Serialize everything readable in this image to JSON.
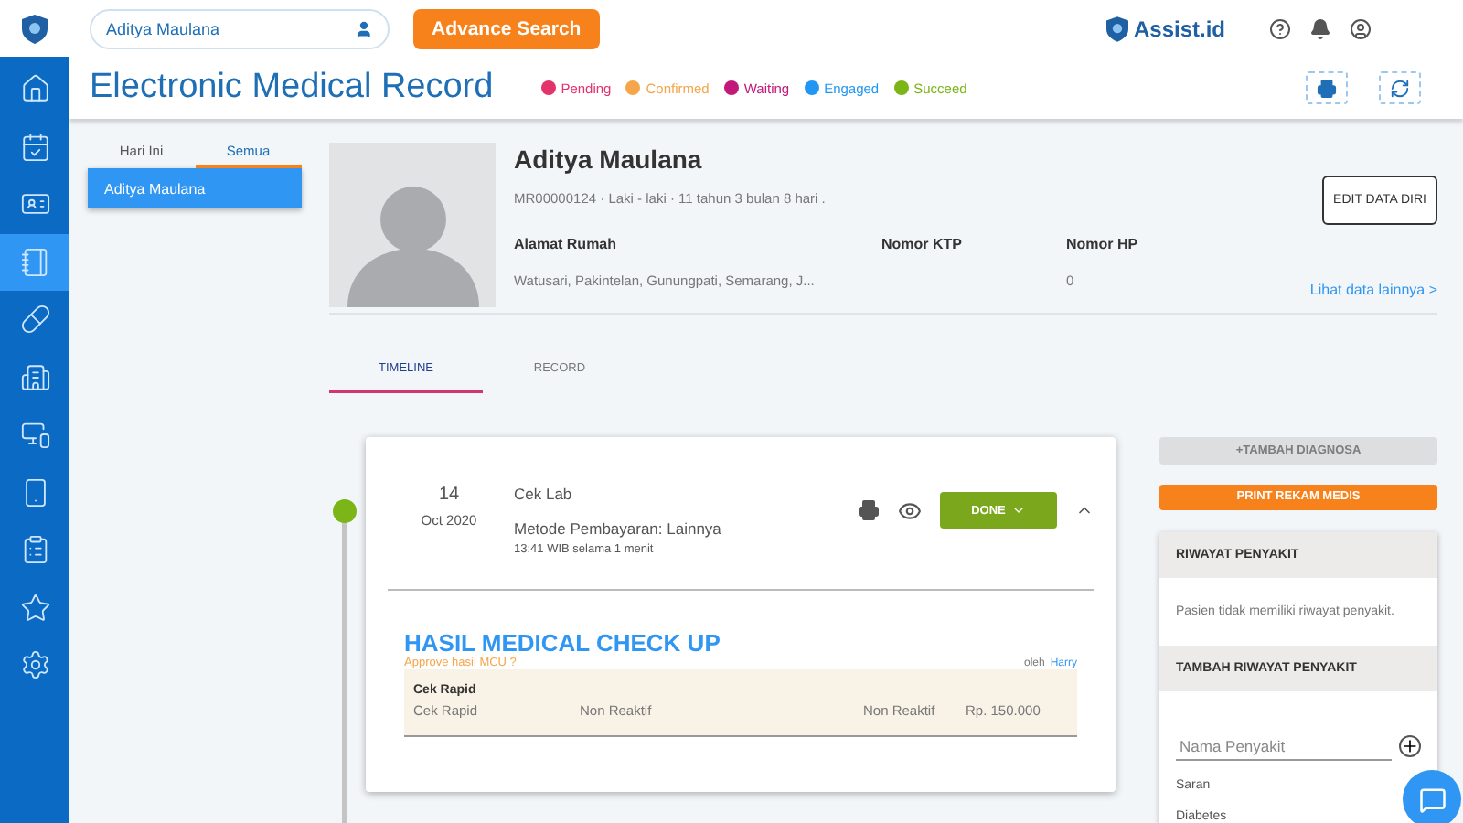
{
  "header": {
    "search": {
      "value": "Aditya Maulana"
    },
    "advance_search": "Advance Search",
    "brand": "Assist.id"
  },
  "page_title": "Electronic Medical Record",
  "legend": [
    {
      "label": "Pending",
      "color": "#e2336b"
    },
    {
      "label": "Confirmed",
      "color": "#f5a54a"
    },
    {
      "label": "Waiting",
      "color": "#c2187a"
    },
    {
      "label": "Engaged",
      "color": "#2196f3"
    },
    {
      "label": "Succeed",
      "color": "#7cb518"
    }
  ],
  "sidebar": [
    {
      "selected": false
    },
    {
      "selected": false
    },
    {
      "selected": false
    },
    {
      "selected": true
    },
    {
      "selected": false
    },
    {
      "selected": false
    },
    {
      "selected": false
    },
    {
      "selected": false
    },
    {
      "selected": false
    },
    {
      "selected": false
    },
    {
      "selected": false
    }
  ],
  "patient_tabs": [
    {
      "label": "Hari Ini",
      "selected": false
    },
    {
      "label": "Semua",
      "selected": true
    }
  ],
  "patients": [
    {
      "name": "Aditya Maulana",
      "selected": true
    }
  ],
  "profile": {
    "name": "Aditya Maulana",
    "meta": "MR00000124 · Laki - laki · 11 tahun 3 bulan 8 hari .",
    "fields": [
      {
        "label": "Alamat Rumah",
        "value": "Watusari, Pakintelan, Gunungpati, Semarang, J..."
      },
      {
        "label": "Nomor KTP"
      },
      {
        "label": "Nomor HP",
        "value": "0"
      }
    ],
    "edit_button": "EDIT DATA DIRI",
    "more_link": "Lihat data lainnya >"
  },
  "record_tabs": [
    {
      "label": "TIMELINE",
      "selected": true
    },
    {
      "label": "RECORD",
      "selected": false
    }
  ],
  "timeline": [
    {
      "day": "14",
      "month_year": "Oct 2020",
      "title": "Cek Lab",
      "payment": "Metode Pembayaran: Lainnya",
      "time": "13:41 WIB selama 1 menit",
      "status": "DONE",
      "expanded": true,
      "result": {
        "heading": "HASIL MEDICAL CHECK UP",
        "approve_link": "Approve hasil MCU ?",
        "by_label": "oleh",
        "by_name": "Harry",
        "items": [
          {
            "group": "Cek Rapid",
            "cells": [
              "Cek Rapid",
              "Non Reaktif",
              "Non Reaktif",
              "Rp. 150.000"
            ]
          }
        ]
      }
    }
  ],
  "actions": [
    {
      "label": "+TAMBAH DIAGNOSA",
      "disabled": true
    },
    {
      "label": "PRINT REKAM MEDIS",
      "disabled": false
    }
  ],
  "history": {
    "title": "RIWAYAT PENYAKIT",
    "empty_text": "Pasien tidak memiliki riwayat penyakit.",
    "add_title": "TAMBAH RIWAYAT PENYAKIT",
    "input": {
      "placeholder": "Nama Penyakit"
    },
    "suggestions_label": "Saran",
    "suggestions": [
      "Diabetes"
    ]
  }
}
